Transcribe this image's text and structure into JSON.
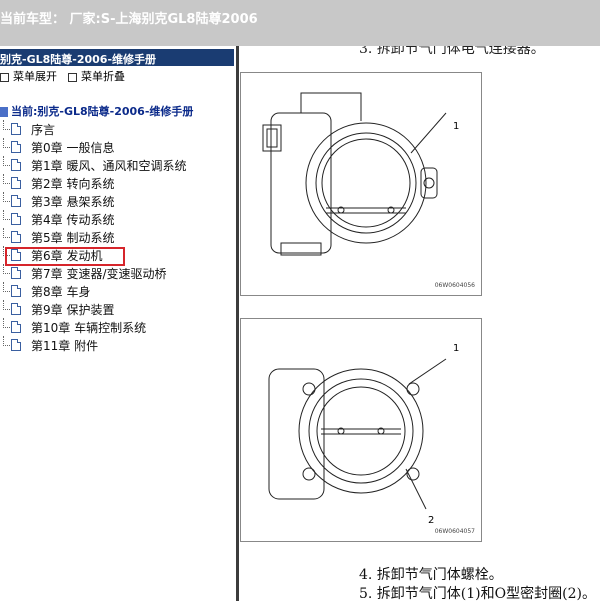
{
  "window": {
    "title": "当前车型： 厂家:S-上海别克GL8陆尊2006"
  },
  "sidebar": {
    "header": "别克-GL8陆尊-2006-维修手册",
    "expand_label": "菜单展开",
    "collapse_label": "菜单折叠",
    "current_label": "当前:别克-GL8陆尊-2006-维修手册",
    "items": [
      {
        "label": "序言"
      },
      {
        "label": "第0章 一般信息"
      },
      {
        "label": "第1章 暖风、通风和空调系统"
      },
      {
        "label": "第2章 转向系统"
      },
      {
        "label": "第3章 悬架系统"
      },
      {
        "label": "第4章 传动系统"
      },
      {
        "label": "第5章 制动系统"
      },
      {
        "label": "第6章 发动机"
      },
      {
        "label": "第7章 变速器/变速驱动桥"
      },
      {
        "label": "第8章 车身"
      },
      {
        "label": "第9章 保护装置"
      },
      {
        "label": "第10章 车辆控制系统"
      },
      {
        "label": "第11章 附件"
      }
    ],
    "highlight_color": "#d6252b"
  },
  "content": {
    "top_step_text": "3. 拆卸节气门体电气连接器。",
    "figure1": {
      "code": "06W0604056",
      "callouts": [
        "1"
      ]
    },
    "figure2": {
      "code": "06W0604057",
      "callouts": [
        "1",
        "2"
      ]
    },
    "steps": [
      "4. 拆卸节气门体螺栓。",
      "5. 拆卸节气门体(1)和O型密封圈(2)。"
    ]
  }
}
